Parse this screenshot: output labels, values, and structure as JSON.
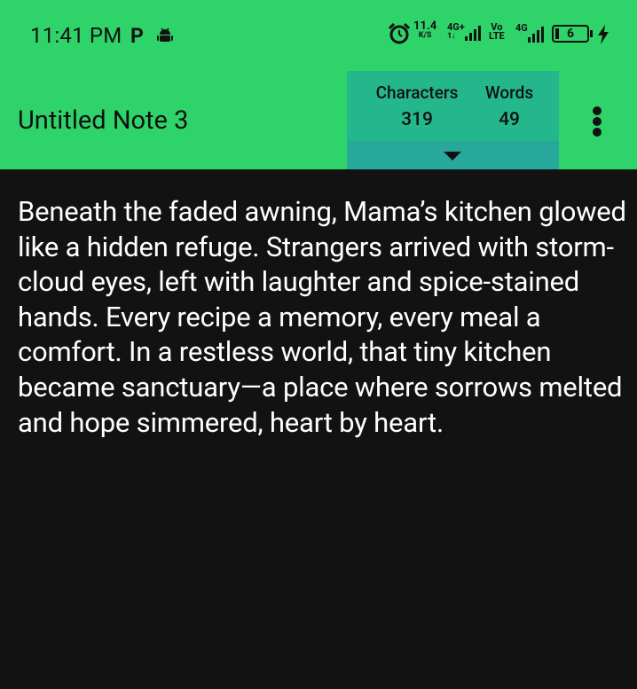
{
  "status_bar": {
    "time": "11:41 PM",
    "p_label": "P",
    "speed_value": "11.4",
    "speed_unit": "K/S",
    "network_type_1": "4G+",
    "network_type_1_sub": "1↓",
    "volte_top": "Vo",
    "volte_bottom": "LTE",
    "network_type_2": "4G",
    "battery_level": "6",
    "icons": [
      "android-icon",
      "alarm-icon",
      "signal-icon",
      "battery-icon",
      "charging-icon"
    ]
  },
  "header": {
    "title": "Untitled Note 3",
    "counter": {
      "characters_label": "Characters",
      "characters_value": "319",
      "words_label": "Words",
      "words_value": "49"
    },
    "menu_icon": "more-vertical-icon"
  },
  "note": {
    "body": "Beneath the faded awning, Mama’s kitchen glowed like a hidden refuge. Strangers arrived with storm-cloud eyes, left with laughter and spice-stained hands. Every recipe a memory, every meal a comfort. In a restless world, that tiny kitchen became sanctuary—a place where sorrows melted and hope simmered, heart by heart."
  },
  "colors": {
    "header_green": "#2ed469",
    "counter_panel": "#25b78c",
    "counter_expand": "#27a89a",
    "background": "#121212",
    "text": "#ffffff"
  }
}
